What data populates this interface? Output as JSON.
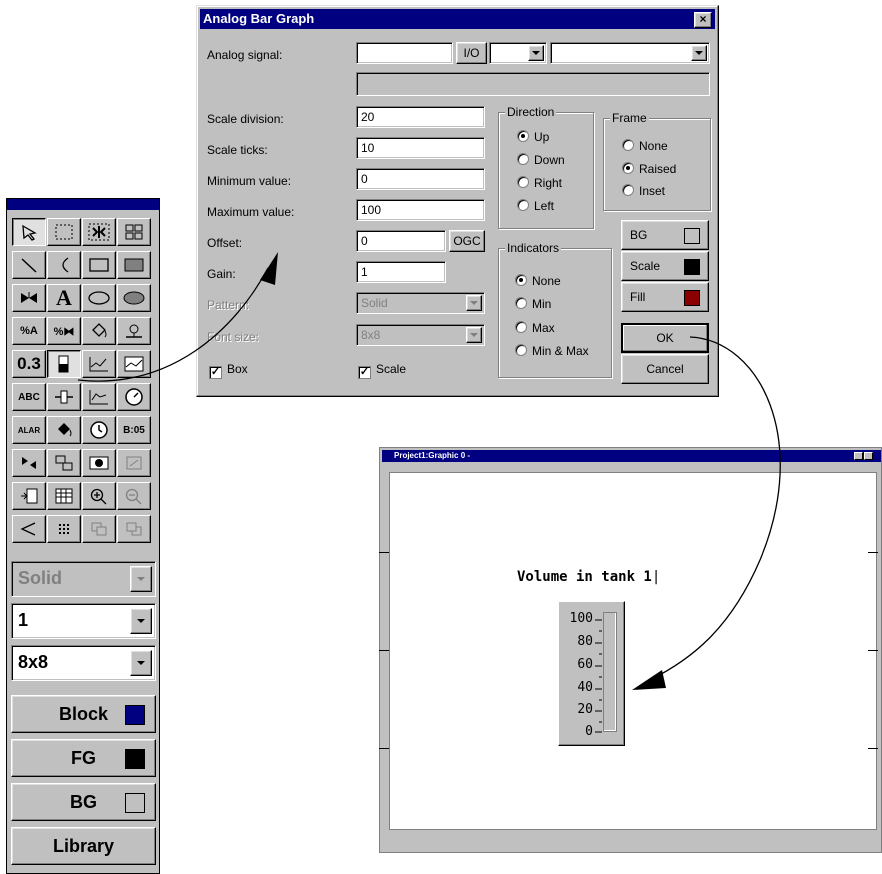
{
  "dialog": {
    "title": "Analog Bar Graph",
    "close_glyph": "×",
    "labels": {
      "analog_signal": "Analog signal:",
      "scale_division": "Scale division:",
      "scale_ticks": "Scale ticks:",
      "minimum_value": "Minimum value:",
      "maximum_value": "Maximum value:",
      "offset": "Offset:",
      "gain": "Gain:",
      "pattern": "Pattern:",
      "font_size": "Font size:"
    },
    "values": {
      "analog_signal": "",
      "scale_division": "20",
      "scale_ticks": "10",
      "minimum_value": "0",
      "maximum_value": "100",
      "offset": "0",
      "gain": "1",
      "pattern": "Solid",
      "font_size": "8x8"
    },
    "io_button": "I/O",
    "ogc_button": "OGC",
    "direction": {
      "legend": "Direction",
      "options": [
        "Up",
        "Down",
        "Right",
        "Left"
      ],
      "selected": "Up"
    },
    "frame": {
      "legend": "Frame",
      "options": [
        "None",
        "Raised",
        "Inset"
      ],
      "selected": "Raised"
    },
    "indicators": {
      "legend": "Indicators",
      "options": [
        "None",
        "Min",
        "Max",
        "Min & Max"
      ],
      "selected": "None"
    },
    "checkboxes": {
      "box": "Box",
      "scale": "Scale"
    },
    "color_buttons": {
      "bg": "BG",
      "scale": "Scale",
      "fill": "Fill"
    },
    "ok": "OK",
    "cancel": "Cancel"
  },
  "toolbox": {
    "pattern": "Solid",
    "line_width": "1",
    "font_size": "8x8",
    "block": "Block",
    "fg": "FG",
    "bg": "BG",
    "library": "Library",
    "value_tool_label": "0.3",
    "abc_label": "ABC",
    "alar_label": "ALAR",
    "time_label": "B:05"
  },
  "graphic_window": {
    "title": "Project1:Graphic 0 -",
    "text_label": "Volume in tank 1",
    "scale_ticks": [
      "100",
      "80",
      "60",
      "40",
      "20",
      "0"
    ]
  },
  "colors": {
    "titlebar": "#000080",
    "block_swatch": "#000080",
    "fg_swatch": "#000000",
    "bg_swatch": "#c0c0c0",
    "fill_swatch": "#8b0000",
    "scale_swatch": "#000000"
  }
}
